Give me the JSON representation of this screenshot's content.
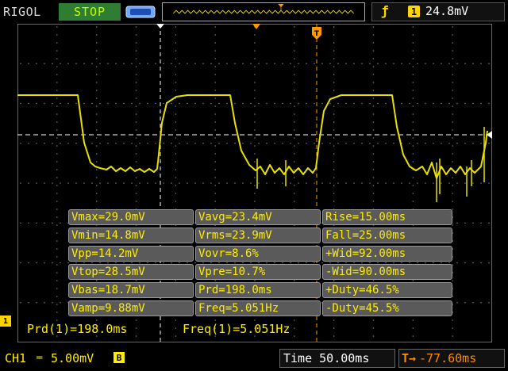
{
  "header": {
    "brand": "RIGOL",
    "run_state": "STOP",
    "trigger": {
      "edge_icon": "rising-edge-icon",
      "source": "1",
      "level": "24.8mV"
    }
  },
  "measurements": [
    [
      "Vmax=29.0mV",
      "Vavg=23.4mV",
      "Rise=15.00ms"
    ],
    [
      "Vmin=14.8mV",
      "Vrms=23.9mV",
      "Fall=25.00ms"
    ],
    [
      "Vpp=14.2mV",
      "Vovr=8.6%",
      "+Wid=92.00ms"
    ],
    [
      "Vtop=28.5mV",
      "Vpre=10.7%",
      "-Wid=90.00ms"
    ],
    [
      "Vbas=18.7mV",
      "Prd=198.0ms",
      "+Duty=46.5%"
    ],
    [
      "Vamp=9.88mV",
      "Freq=5.051Hz",
      "-Duty=45.5%"
    ]
  ],
  "readout": {
    "period": "Prd(1)=198.0ms",
    "frequency": "Freq(1)=5.051Hz"
  },
  "channel": {
    "marker": "1",
    "label": "CH1",
    "coupling_icon": "dc-coupling-icon",
    "scale": "5.00mV",
    "bandwidth_limit": "B"
  },
  "timebase": {
    "label": "Time",
    "value": "50.00ms"
  },
  "offset": {
    "icon": "trigger-offset-icon",
    "value": "-77.60ms"
  },
  "colors": {
    "trace": "#e8e000",
    "cursor": "#ff9900",
    "accent": "#ffee00",
    "stop_bg": "#2e7d32"
  }
}
